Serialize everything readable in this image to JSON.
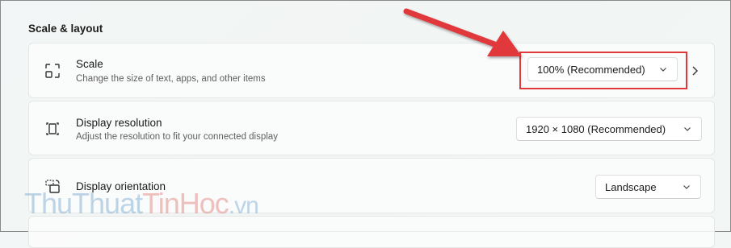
{
  "section": {
    "title": "Scale & layout"
  },
  "scale": {
    "icon": "scale-icon",
    "title": "Scale",
    "description": "Change the size of text, apps, and other items",
    "value": "100% (Recommended)"
  },
  "resolution": {
    "icon": "display-resolution-icon",
    "title": "Display resolution",
    "description": "Adjust the resolution to fit your connected display",
    "value": "1920 × 1080 (Recommended)"
  },
  "orientation": {
    "icon": "display-orientation-icon",
    "title": "Display orientation",
    "value": "Landscape"
  },
  "watermark": {
    "part1": "ThuThuat",
    "part2": "TinHoc",
    "part3": ".vn"
  },
  "colors": {
    "annotation_red": "#e0383b"
  }
}
